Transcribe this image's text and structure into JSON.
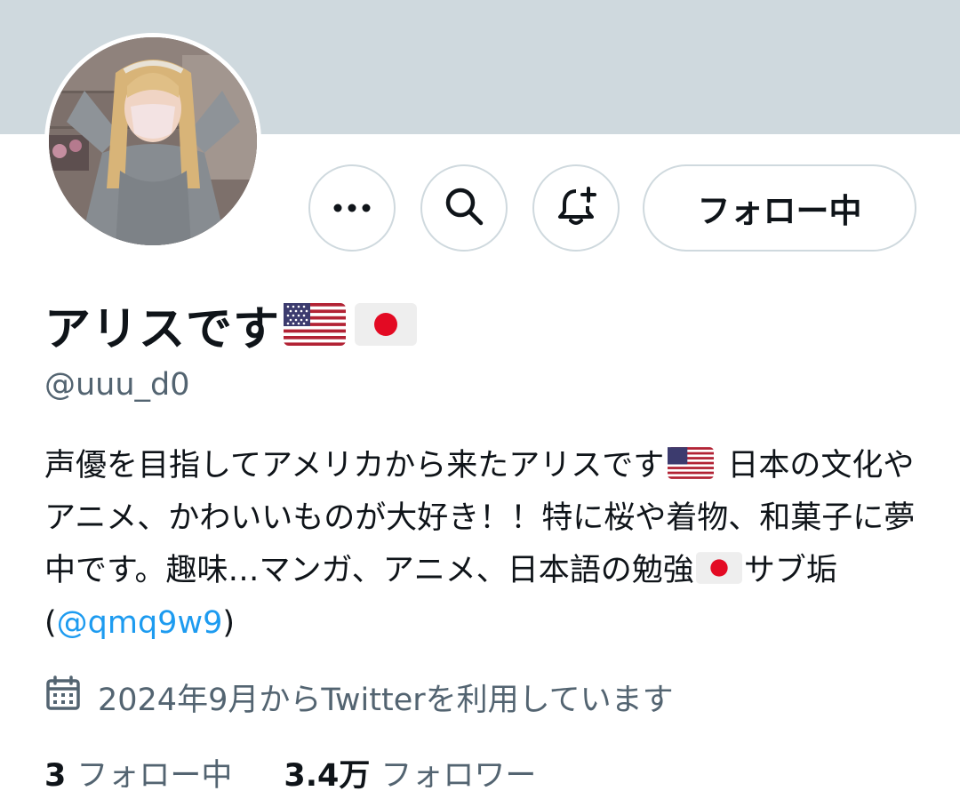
{
  "header": {
    "banner_color": "#cfd9de"
  },
  "profile": {
    "display_name": "アリスです",
    "name_emoji": [
      "flag-us-icon",
      "flag-jp-icon"
    ],
    "handle": "@uuu_d0",
    "bio": {
      "part1": "声優を目指してアメリカから来たアリスです",
      "part2": " 日本の文化やアニメ、かわいいものが大好き！！特に桜や着物、和菓子に夢中です。趣味…マンガ、アニメ、日本語の勉強",
      "part3": "サブ垢(",
      "mention": "@qmq9w9",
      "part4": ")"
    },
    "joined": "2024年9月からTwitterを利用しています"
  },
  "actions": {
    "more_icon": "more-horizontal-icon",
    "search_icon": "search-icon",
    "notify_icon": "bell-plus-icon",
    "follow_label": "フォロー中"
  },
  "stats": {
    "following_count": "3",
    "following_label": "フォロー中",
    "followers_count": "3.4万",
    "followers_label": "フォロワー"
  },
  "colors": {
    "accent": "#1d9bf0",
    "text_primary": "#0f1419",
    "text_secondary": "#536471",
    "border": "#cfd9de"
  }
}
